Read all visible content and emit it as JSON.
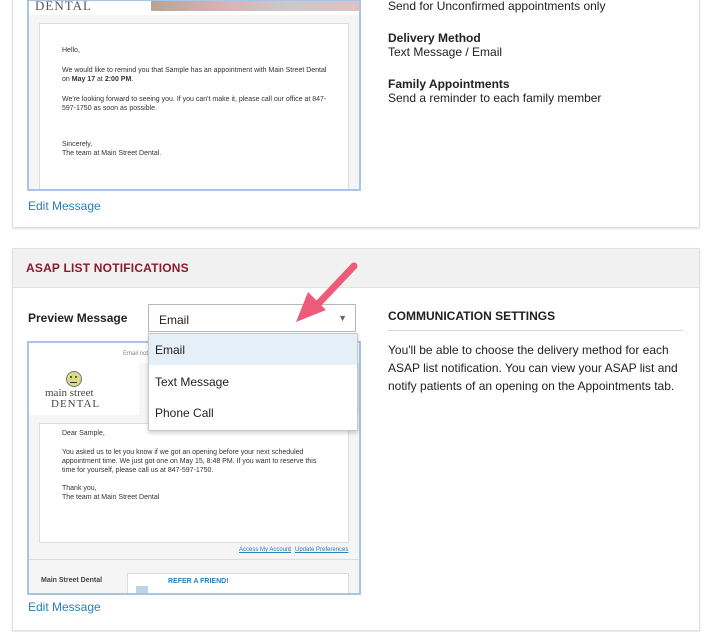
{
  "reminder": {
    "logo_text": "DENTAL",
    "email": {
      "greeting": "Hello,",
      "body1_a": "We would like to remind you that Sample has an appointment with Main Street Dental",
      "body1_b_prefix": "on ",
      "body1_b_date": "May 17",
      "body1_b_mid": " at ",
      "body1_b_time": "2:00 PM",
      "body1_b_end": ".",
      "body2_a": "We're looking forward to seeing you. If you can't make it, please call our office at 847-",
      "body2_b": "597-1750 as soon as possible.",
      "closing": "Sincerely,",
      "signature": "The team at Main Street Dental."
    },
    "edit_link": "Edit Message",
    "settings": {
      "unconfirmed_note": "Send for Unconfirmed appointments only",
      "delivery_method_label": "Delivery Method",
      "delivery_method_value": "Text Message / Email",
      "family_label": "Family Appointments",
      "family_value": "Send a reminder to each family member"
    }
  },
  "asap": {
    "title": "ASAP LIST NOTIFICATIONS",
    "preview_label": "Preview Message",
    "select": {
      "selected": "Email",
      "options": [
        "Email",
        "Text Message",
        "Phone Call"
      ]
    },
    "email": {
      "top_note": "Email not",
      "logo_top": "main street",
      "logo_bottom": "DENTAL",
      "greeting": "Dear Sample,",
      "body_1": "You asked us to let you know if we got an opening before your next scheduled",
      "body_2": "appointment time. We just got one on May 15, 8:48 PM. If you want to reserve this",
      "body_3": "time for yourself, please call us at 847-597-1750.",
      "closing": "Thank you,",
      "signature": "The team at Main Street Dental",
      "footer_link1": "Access My Account",
      "footer_sep": "|",
      "footer_link2": "Update Preferences",
      "practice": "Main Street Dental",
      "refer": "REFER A FRIEND!"
    },
    "edit_link": "Edit Message",
    "comm_settings": {
      "heading": "COMMUNICATION SETTINGS",
      "line1": "You'll be able to choose the delivery method for each",
      "line2": "ASAP list notification. You can view your ASAP list and",
      "line3": "notify patients of an opening on the Appointments tab."
    }
  },
  "colors": {
    "title_red": "#8b1a2b",
    "link_blue": "#2a7fb8",
    "arrow_pink": "#ee5a79",
    "preview_border": "#a7c6e6"
  }
}
